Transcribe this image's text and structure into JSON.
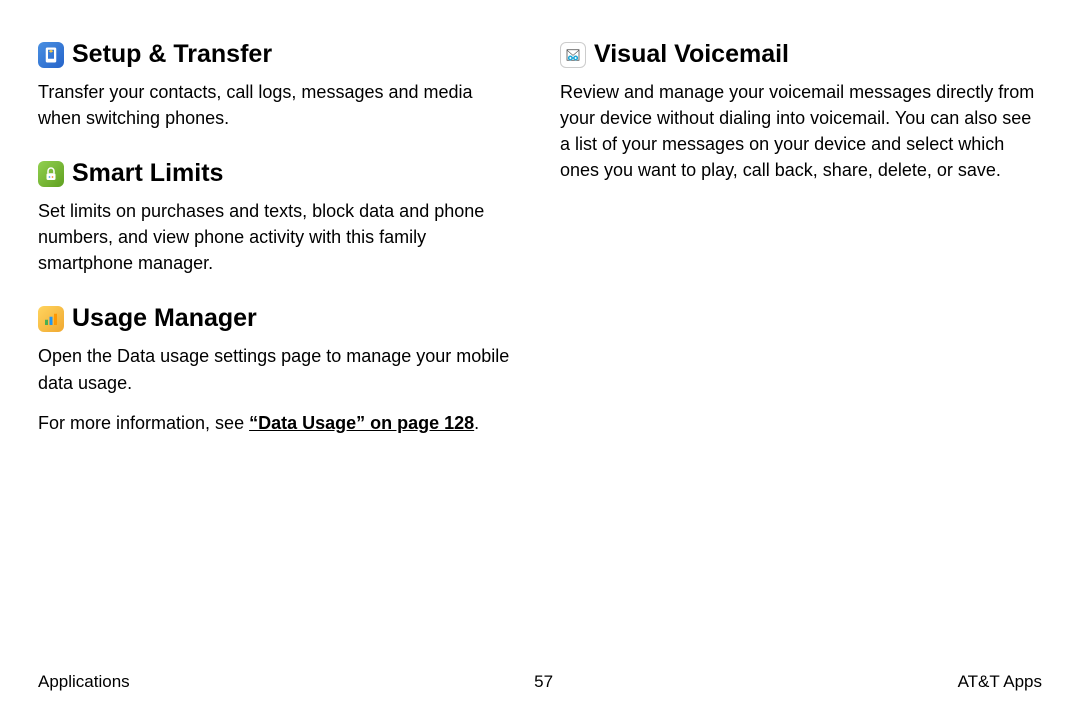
{
  "left_column": {
    "setup_transfer": {
      "title": "Setup & Transfer",
      "desc": "Transfer your contacts, call logs, messages and media when switching phones."
    },
    "smart_limits": {
      "title": "Smart Limits",
      "desc": "Set limits on purchases and texts, block data and phone numbers, and view phone activity with this family smartphone manager."
    },
    "usage_manager": {
      "title": "Usage Manager",
      "desc": "Open the Data usage settings page to manage your mobile data usage.",
      "more_info_prefix": "For more information, see ",
      "link_text": "“Data Usage” on page 128",
      "more_info_suffix": "."
    }
  },
  "right_column": {
    "visual_voicemail": {
      "title": "Visual Voicemail",
      "desc": "Review and manage your voicemail messages directly from your device without dialing into voicemail. You can also see a list of your messages on your device and select which ones you want to play, call back, share, delete, or save."
    }
  },
  "footer": {
    "left": "Applications",
    "center": "57",
    "right": "AT&T Apps"
  }
}
